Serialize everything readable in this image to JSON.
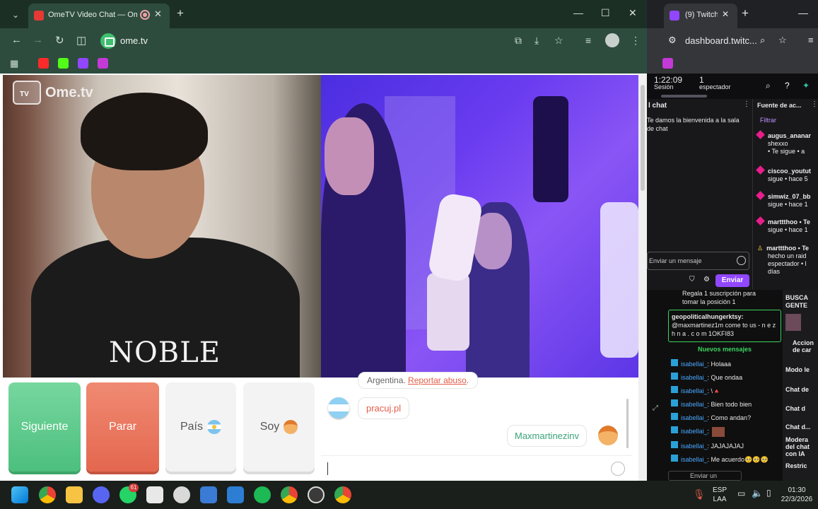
{
  "left_browser": {
    "tab_title": "OmeTV Video Chat — Ome",
    "url": "ome.tv"
  },
  "video": {
    "logo_text": "Ome.tv",
    "logo_tv": "TV",
    "shirt_text": "NOBLE"
  },
  "buttons": {
    "next": "Siguiente",
    "stop": "Parar",
    "country": "País",
    "gender": "Soy"
  },
  "chat": {
    "system_country": "Argentina.",
    "report_link": "Reportar abuso",
    "incoming_message": "pracuj.pl",
    "outgoing_message": "Maxmartinezinv"
  },
  "right_browser": {
    "tab_title": "(9) Twitch",
    "url": "dashboard.twitc..."
  },
  "twitch": {
    "session_time": "1:22:09",
    "session_label": "Sesión",
    "viewers": "1",
    "viewers_label": "espectador",
    "chat_header": "l chat",
    "chat_welcome": "Te damos la bienvenida a la sala de chat",
    "feed_header": "Fuente de ac...",
    "filter_label": "Filtrar",
    "feed": [
      {
        "user": "augus_ananar",
        "line2": "shexxo",
        "line3": "• Te sigue • a"
      },
      {
        "user": "ciscoo_youtut",
        "line2": "sigue • hace 5",
        "line3": ""
      },
      {
        "user": "simwiz_07_bb",
        "line2": "sigue • hace 1",
        "line3": ""
      },
      {
        "user": "marttthoo • Te",
        "line2": "sigue • hace 1",
        "line3": ""
      },
      {
        "user": "marttthoo • Te",
        "line2": "hecho un raid",
        "line3": "espectador • l"
      }
    ],
    "feed_last": "días",
    "message_placeholder": "Enviar un mensaje",
    "send_label": "Enviar"
  },
  "obs_chat": {
    "top_line1": "Regala 1 suscripción para",
    "top_line2": "tomar la posición 1",
    "highlight_user": "geopoliticalhungerktsy:",
    "highlight_text1": "@maxmartinez1m come to us - n e z",
    "highlight_text2": "h n a . c o m 1OKFI83",
    "new_messages": "Nuevos mensajes",
    "messages": [
      {
        "user": "isabellai_",
        "text": ": Holaaa"
      },
      {
        "user": "isabellai_",
        "text": ": Que ondaa"
      },
      {
        "user": "isabellai_",
        "text": ": \\🔺"
      },
      {
        "user": "isabellai_",
        "text": ": Bien todo bien"
      },
      {
        "user": "isabellai_",
        "text": ": Como andan?"
      },
      {
        "user": "isabellai_",
        "text": ":"
      },
      {
        "user": "isabellai_",
        "text": ": JAJAJAJAJ"
      },
      {
        "user": "isabellai_",
        "text": ": Me acuerdo🥺🥺🥺"
      }
    ],
    "bottom_input": "Enviar un"
  },
  "side_panel": {
    "items": [
      "BUSCA",
      "GENTE",
      "Accion",
      "de car",
      "Modo le",
      "Chat de",
      "Chat d",
      "Chat d...",
      "Modera",
      "del chat",
      "con IA",
      "Restric"
    ]
  },
  "taskbar": {
    "whatsapp_badge": "61",
    "lang1": "ESP",
    "lang2": "LAA",
    "time": "01:30",
    "date": "22/3/2026"
  }
}
